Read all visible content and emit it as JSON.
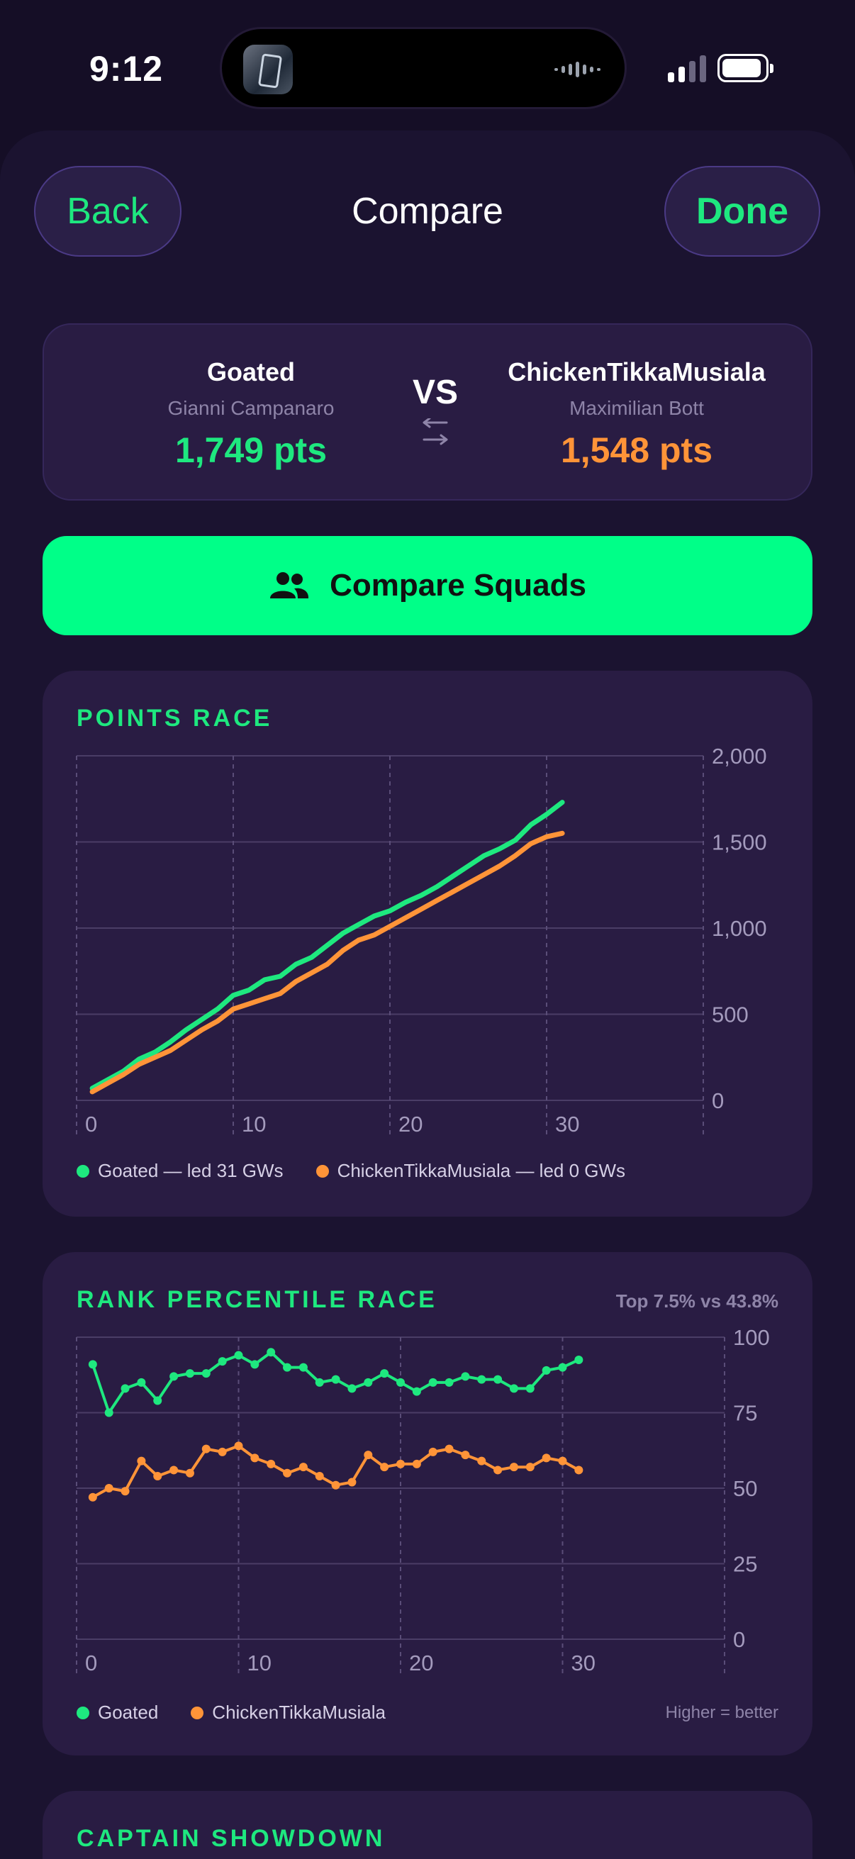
{
  "status_bar": {
    "time": "9:12"
  },
  "nav": {
    "back_label": "Back",
    "title": "Compare",
    "done_label": "Done"
  },
  "matchup": {
    "left": {
      "team": "Goated",
      "manager": "Gianni Campanaro",
      "points": "1,749 pts"
    },
    "vs": "VS",
    "right": {
      "team": "ChickenTikkaMusiala",
      "manager": "Maximilian Bott",
      "points": "1,548 pts"
    }
  },
  "compare_button": {
    "label": "Compare Squads",
    "icon": "people-icon"
  },
  "colors": {
    "green": "#1ee87f",
    "orange": "#ff9438",
    "button": "#00ff88"
  },
  "points_race": {
    "title": "POINTS RACE",
    "legend": [
      "Goated — led 31 GWs",
      "ChickenTikkaMusiala — led 0 GWs"
    ]
  },
  "rank_race": {
    "title": "RANK PERCENTILE RACE",
    "summary": "Top 7.5% vs 43.8%",
    "legend": [
      "Goated",
      "ChickenTikkaMusiala"
    ],
    "note": "Higher = better"
  },
  "captain": {
    "title": "CAPTAIN SHOWDOWN"
  },
  "chart_data": [
    {
      "type": "line",
      "title": "POINTS RACE",
      "x_ticks": [
        0,
        10,
        20,
        30
      ],
      "y_ticks": [
        "0",
        "500",
        "1,000",
        "1,500",
        "2,000"
      ],
      "xlim": [
        0,
        40
      ],
      "ylim": [
        0,
        2000
      ],
      "grid": true,
      "legend_position": "bottom",
      "x": [
        1,
        2,
        3,
        4,
        5,
        6,
        7,
        8,
        9,
        10,
        11,
        12,
        13,
        14,
        15,
        16,
        17,
        18,
        19,
        20,
        21,
        22,
        23,
        24,
        25,
        26,
        27,
        28,
        29,
        30,
        31
      ],
      "series": [
        {
          "name": "Goated",
          "color": "#1ee87f",
          "values": [
            70,
            120,
            170,
            240,
            280,
            340,
            410,
            470,
            530,
            610,
            640,
            700,
            720,
            790,
            830,
            900,
            970,
            1020,
            1070,
            1100,
            1150,
            1190,
            1240,
            1300,
            1360,
            1420,
            1460,
            1510,
            1600,
            1660,
            1730
          ]
        },
        {
          "name": "ChickenTikkaMusiala",
          "color": "#ff9438",
          "values": [
            50,
            100,
            150,
            210,
            250,
            290,
            350,
            410,
            460,
            530,
            560,
            590,
            620,
            690,
            740,
            790,
            870,
            930,
            960,
            1010,
            1060,
            1110,
            1160,
            1210,
            1260,
            1310,
            1360,
            1420,
            1490,
            1530,
            1550
          ]
        }
      ]
    },
    {
      "type": "line",
      "title": "RANK PERCENTILE RACE",
      "x_ticks": [
        0,
        10,
        20,
        30
      ],
      "y_ticks": [
        "0",
        "25",
        "50",
        "75",
        "100"
      ],
      "xlim": [
        0,
        40
      ],
      "ylim": [
        0,
        100
      ],
      "grid": true,
      "legend_position": "bottom",
      "x": [
        1,
        2,
        3,
        4,
        5,
        6,
        7,
        8,
        9,
        10,
        11,
        12,
        13,
        14,
        15,
        16,
        17,
        18,
        19,
        20,
        21,
        22,
        23,
        24,
        25,
        26,
        27,
        28,
        29,
        30,
        31
      ],
      "series": [
        {
          "name": "Goated",
          "color": "#1ee87f",
          "values": [
            91,
            75,
            83,
            85,
            79,
            87,
            88,
            88,
            92,
            94,
            91,
            95,
            90,
            90,
            85,
            86,
            83,
            85,
            88,
            85,
            82,
            85,
            85,
            87,
            86,
            86,
            83,
            83,
            89,
            90,
            92.5
          ]
        },
        {
          "name": "ChickenTikkaMusiala",
          "color": "#ff9438",
          "values": [
            47,
            50,
            49,
            59,
            54,
            56,
            55,
            63,
            62,
            64,
            60,
            58,
            55,
            57,
            54,
            51,
            52,
            61,
            57,
            58,
            58,
            62,
            63,
            61,
            59,
            56,
            57,
            57,
            60,
            59,
            56
          ]
        }
      ]
    }
  ]
}
